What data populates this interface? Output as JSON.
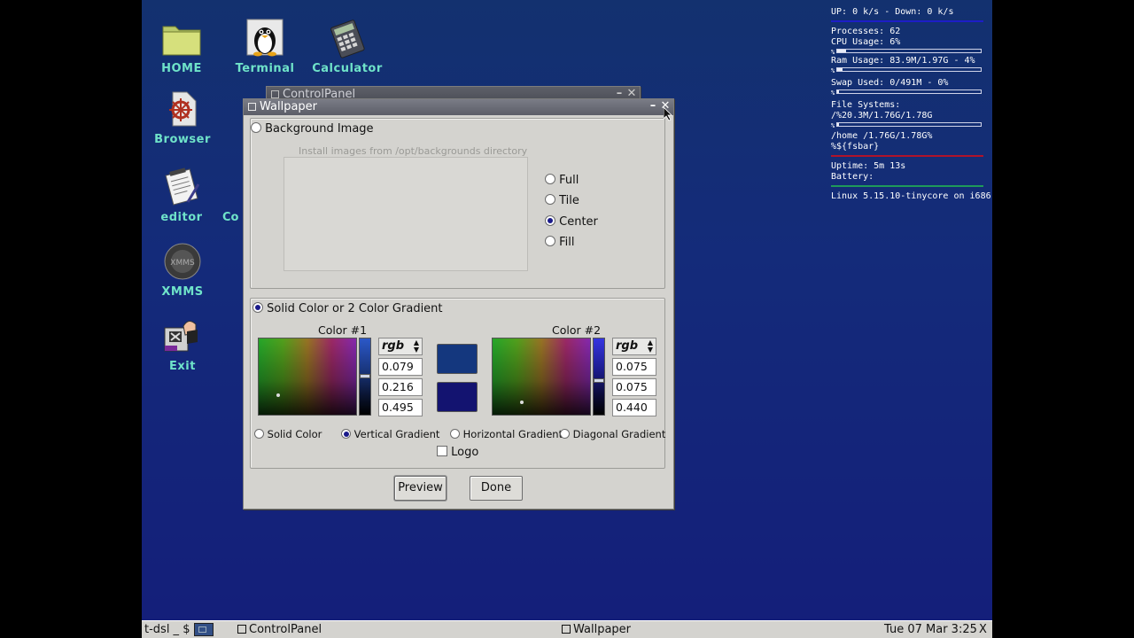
{
  "desktop": {
    "icons": [
      {
        "label": "HOME",
        "icon": "folder-icon"
      },
      {
        "label": "Terminal",
        "icon": "tux-terminal-icon"
      },
      {
        "label": "Calculator",
        "icon": "calculator-icon"
      },
      {
        "label": "Browser",
        "icon": "browser-icon"
      },
      {
        "label": "editor",
        "icon": "editor-icon"
      },
      {
        "label": "XMMS",
        "icon": "xmms-icon"
      },
      {
        "label": "Exit",
        "icon": "exit-icon"
      }
    ],
    "partial_label": "Co"
  },
  "conky": {
    "net": "UP: 0 k/s - Down: 0 k/s",
    "processes": "Processes: 62",
    "cpu": "CPU Usage: 6%",
    "cpu_bar_label": "%",
    "cpu_fraction": 0.06,
    "ram": "Ram Usage: 83.9M/1.97G - 4%",
    "ram_bar_label": "%",
    "ram_fraction": 0.04,
    "swap": "Swap Used: 0/491M - 0%",
    "swap_bar_label": "%",
    "swap_fraction": 0.0,
    "fs_title": "File Systems:",
    "fs_root": "/%20.3M/1.76G/1.78G",
    "fs_root_bar_label": "%",
    "fs_root_fraction": 0.01,
    "fs_home": "/home   /1.76G/1.78G%",
    "fs_home_extra": "%${fsbar}",
    "uptime": "Uptime:  5m 13s",
    "battery": "Battery:",
    "kernel": "Linux 5.15.10-tinycore on i686"
  },
  "controlpanel": {
    "title": "ControlPanel"
  },
  "wallpaper": {
    "title": "Wallpaper",
    "background_image": {
      "label": "Background Image",
      "hint": "Install images from /opt/backgrounds directory",
      "modes": [
        "Full",
        "Tile",
        "Center",
        "Fill"
      ],
      "selected_mode": "Center"
    },
    "solid_section": {
      "label": "Solid Color or 2 Color Gradient",
      "color1": {
        "title": "Color #1",
        "mode": "rgb",
        "r": "0.079",
        "g": "0.216",
        "b": "0.495",
        "hex": "#14377e"
      },
      "color2": {
        "title": "Color #2",
        "mode": "rgb",
        "r": "0.075",
        "g": "0.075",
        "b": "0.440",
        "hex": "#131370"
      },
      "gradient_modes": [
        "Solid Color",
        "Vertical Gradient",
        "Horizontal Gradient",
        "Diagonal Gradient"
      ],
      "selected_gradient": "Vertical Gradient",
      "logo_label": "Logo",
      "logo_checked": false
    },
    "buttons": {
      "preview": "Preview",
      "done": "Done"
    }
  },
  "taskbar": {
    "shell": "t-dsl  _  $",
    "tasks": [
      "ControlPanel",
      "Wallpaper"
    ],
    "datetime": "Tue 07 Mar  3:25",
    "close_glyph": "X"
  }
}
